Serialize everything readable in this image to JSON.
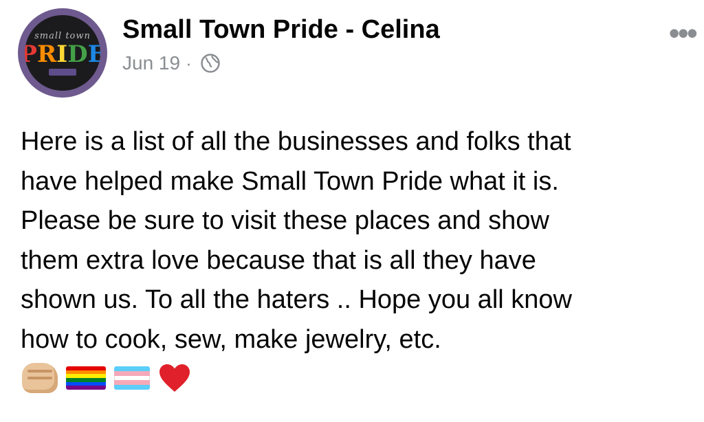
{
  "post": {
    "page_name": "Small Town Pride - Celina",
    "date": "Jun 19",
    "separator": "·",
    "text_lines": [
      "Here is a list of all the businesses and folks that",
      "have helped make Small Town Pride what it is.",
      "Please be sure to visit these places and show",
      "them extra love because that is all they have",
      "shown us. To all the haters .. Hope you all know",
      "how to cook, sew, make jewelry, etc."
    ],
    "more_label": "•••"
  },
  "avatar": {
    "top_text": "small town",
    "word_letters": [
      "P",
      "R",
      "I",
      "D",
      "E"
    ]
  },
  "icons": {
    "avatar": "pride-logo",
    "audience": "globe-icon",
    "more": "ellipsis-icon",
    "emojis": [
      "fist-icon",
      "rainbow-flag-icon",
      "transgender-flag-icon",
      "red-heart-icon"
    ]
  },
  "colors": {
    "name": "#050505",
    "meta": "#8a8d91",
    "avatar_ring": "#6e5a8e",
    "heart": "#e0202a",
    "rainbow": [
      "#e40303",
      "#ff8c00",
      "#ffed00",
      "#008026",
      "#004dff",
      "#750787"
    ],
    "trans": [
      "#5bcefa",
      "#f5a9b8",
      "#ffffff",
      "#f5a9b8",
      "#5bcefa"
    ]
  }
}
